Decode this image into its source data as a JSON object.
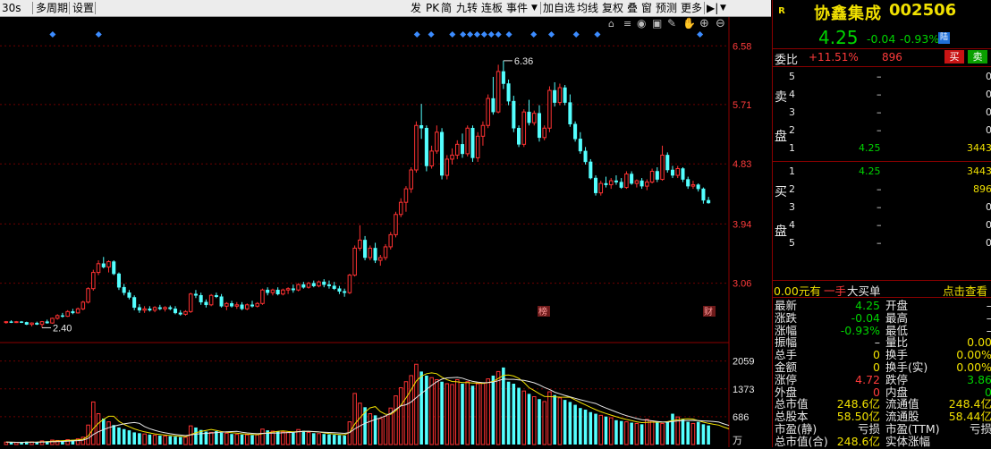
{
  "toolbar": {
    "left_items": [
      "30s",
      "多周期",
      "设置"
    ],
    "right_items": [
      "发",
      "PK",
      "简",
      "九转",
      "连板",
      "事件",
      "加自选",
      "均线",
      "复权",
      "叠",
      "窗",
      "预测",
      "更多"
    ],
    "icons": [
      "dropdown-arrow-icon",
      "home-icon",
      "eye-icon",
      "image-icon",
      "brush-icon",
      "hand-icon",
      "zoom-in-icon",
      "zoom-out-icon",
      "export-icon"
    ]
  },
  "stock": {
    "badge": "R",
    "name": "协鑫集成",
    "code": "002506",
    "price": "4.25",
    "change": "-0.04",
    "change_pct": "-0.93%",
    "tag": "陆"
  },
  "order_book": {
    "weibi_label": "委比",
    "weibi_value": "+11.51%",
    "weibi_diff": "896",
    "buy_btn": "买",
    "sell_btn": "卖",
    "sell_label": "卖盘",
    "buy_label": "买盘",
    "sell": [
      {
        "level": "5",
        "price": "–",
        "vol": "0"
      },
      {
        "level": "4",
        "price": "–",
        "vol": "0"
      },
      {
        "level": "3",
        "price": "–",
        "vol": "0"
      },
      {
        "level": "2",
        "price": "–",
        "vol": "0"
      },
      {
        "level": "1",
        "price": "4.25",
        "vol": "3443"
      }
    ],
    "buy": [
      {
        "level": "1",
        "price": "4.25",
        "vol": "3443"
      },
      {
        "level": "2",
        "price": "–",
        "vol": "896"
      },
      {
        "level": "3",
        "price": "–",
        "vol": "0"
      },
      {
        "level": "4",
        "price": "–",
        "vol": "0"
      },
      {
        "level": "5",
        "price": "–",
        "vol": "0"
      }
    ],
    "big_buy_left": "0.00元有",
    "big_buy_mid": "一手",
    "big_buy_right": "大买单",
    "big_buy_link": "点击查看"
  },
  "stats": [
    {
      "l1": "最新",
      "v1": "4.25",
      "c1": "green",
      "l2": "开盘",
      "v2": "–",
      "c2": "white"
    },
    {
      "l1": "涨跌",
      "v1": "-0.04",
      "c1": "green",
      "l2": "最高",
      "v2": "–",
      "c2": "white"
    },
    {
      "l1": "涨幅",
      "v1": "-0.93%",
      "c1": "green",
      "l2": "最低",
      "v2": "–",
      "c2": "white"
    },
    {
      "l1": "振幅",
      "v1": "–",
      "c1": "white",
      "l2": "量比",
      "v2": "0.00",
      "c2": "yellow"
    },
    {
      "l1": "总手",
      "v1": "0",
      "c1": "yellow",
      "l2": "换手",
      "v2": "0.00%",
      "c2": "yellow"
    },
    {
      "l1": "金额",
      "v1": "0",
      "c1": "yellow",
      "l2": "换手(实)",
      "v2": "0.00%",
      "c2": "yellow"
    },
    {
      "l1": "涨停",
      "v1": "4.72",
      "c1": "red",
      "l2": "跌停",
      "v2": "3.86",
      "c2": "green"
    },
    {
      "l1": "外盘",
      "v1": "0",
      "c1": "red",
      "l2": "内盘",
      "v2": "0",
      "c2": "green"
    },
    {
      "l1": "总市值",
      "v1": "248.6亿",
      "c1": "yellow",
      "l2": "流通值",
      "v2": "248.4亿",
      "c2": "yellow"
    },
    {
      "l1": "总股本",
      "v1": "58.50亿",
      "c1": "yellow",
      "l2": "流通股",
      "v2": "58.44亿",
      "c2": "yellow"
    },
    {
      "l1": "市盈(静)",
      "v1": "亏损",
      "c1": "white",
      "l2": "市盈(TTM)",
      "v2": "亏损",
      "c2": "white"
    },
    {
      "l1": "总市值(合)",
      "v1": "248.6亿",
      "c1": "yellow",
      "l2": "实体涨幅",
      "v2": "",
      "c2": "white"
    }
  ],
  "chart_data": {
    "type": "candlestick",
    "price_axis": {
      "ticks": [
        "6.58",
        "5.71",
        "4.83",
        "3.94",
        "3.06"
      ],
      "range": [
        2.22,
        6.65
      ]
    },
    "volume_axis": {
      "ticks": [
        "2059",
        "1373",
        "686",
        "万"
      ],
      "range": [
        0,
        2250
      ]
    },
    "annotations": {
      "high_label": "6.36",
      "low_label": "2.40",
      "markers": [
        "榜",
        "财"
      ]
    },
    "candles": [
      [
        2.48,
        2.5,
        2.46,
        2.49
      ],
      [
        2.49,
        2.51,
        2.47,
        2.48
      ],
      [
        2.48,
        2.5,
        2.47,
        2.49
      ],
      [
        2.49,
        2.5,
        2.47,
        2.48
      ],
      [
        2.48,
        2.49,
        2.44,
        2.45
      ],
      [
        2.45,
        2.48,
        2.42,
        2.47
      ],
      [
        2.47,
        2.49,
        2.44,
        2.45
      ],
      [
        2.45,
        2.5,
        2.4,
        2.49
      ],
      [
        2.49,
        2.52,
        2.46,
        2.47
      ],
      [
        2.47,
        2.55,
        2.46,
        2.54
      ],
      [
        2.54,
        2.6,
        2.52,
        2.58
      ],
      [
        2.58,
        2.62,
        2.55,
        2.57
      ],
      [
        2.57,
        2.66,
        2.56,
        2.64
      ],
      [
        2.64,
        2.68,
        2.6,
        2.62
      ],
      [
        2.62,
        2.7,
        2.61,
        2.68
      ],
      [
        2.68,
        2.8,
        2.66,
        2.78
      ],
      [
        2.78,
        3.0,
        2.76,
        2.98
      ],
      [
        2.98,
        3.26,
        2.95,
        3.22
      ],
      [
        3.22,
        3.4,
        3.18,
        3.35
      ],
      [
        3.35,
        3.45,
        3.28,
        3.3
      ],
      [
        3.3,
        3.4,
        3.22,
        3.38
      ],
      [
        3.38,
        3.4,
        3.18,
        3.2
      ],
      [
        3.2,
        3.22,
        2.96,
        3.0
      ],
      [
        3.0,
        3.05,
        2.88,
        2.92
      ],
      [
        2.92,
        2.96,
        2.82,
        2.85
      ],
      [
        2.85,
        2.88,
        2.66,
        2.7
      ],
      [
        2.7,
        2.75,
        2.62,
        2.66
      ],
      [
        2.66,
        2.72,
        2.62,
        2.68
      ],
      [
        2.68,
        2.72,
        2.64,
        2.66
      ],
      [
        2.66,
        2.72,
        2.63,
        2.7
      ],
      [
        2.7,
        2.74,
        2.66,
        2.68
      ],
      [
        2.68,
        2.72,
        2.64,
        2.7
      ],
      [
        2.7,
        2.73,
        2.66,
        2.68
      ],
      [
        2.68,
        2.72,
        2.6,
        2.62
      ],
      [
        2.62,
        2.66,
        2.58,
        2.6
      ],
      [
        2.6,
        2.66,
        2.58,
        2.64
      ],
      [
        2.64,
        2.92,
        2.62,
        2.9
      ],
      [
        2.9,
        2.96,
        2.84,
        2.88
      ],
      [
        2.88,
        2.92,
        2.74,
        2.78
      ],
      [
        2.78,
        2.82,
        2.7,
        2.74
      ],
      [
        2.74,
        2.9,
        2.72,
        2.88
      ],
      [
        2.88,
        2.92,
        2.84,
        2.86
      ],
      [
        2.86,
        2.9,
        2.7,
        2.72
      ],
      [
        2.72,
        2.78,
        2.66,
        2.76
      ],
      [
        2.76,
        2.8,
        2.7,
        2.72
      ],
      [
        2.72,
        2.78,
        2.68,
        2.74
      ],
      [
        2.74,
        2.78,
        2.66,
        2.68
      ],
      [
        2.68,
        2.76,
        2.66,
        2.74
      ],
      [
        2.74,
        2.8,
        2.7,
        2.72
      ],
      [
        2.72,
        2.78,
        2.7,
        2.76
      ],
      [
        2.76,
        2.98,
        2.74,
        2.96
      ],
      [
        2.96,
        3.0,
        2.88,
        2.92
      ],
      [
        2.92,
        2.98,
        2.88,
        2.96
      ],
      [
        2.96,
        3.0,
        2.88,
        2.9
      ],
      [
        2.9,
        2.98,
        2.88,
        2.96
      ],
      [
        2.96,
        3.0,
        2.9,
        2.98
      ],
      [
        2.98,
        3.04,
        2.92,
        2.96
      ],
      [
        2.96,
        3.06,
        2.94,
        3.04
      ],
      [
        3.04,
        3.08,
        2.98,
        3.0
      ],
      [
        3.0,
        3.08,
        2.98,
        3.06
      ],
      [
        3.06,
        3.1,
        3.0,
        3.02
      ],
      [
        3.02,
        3.1,
        3.0,
        3.08
      ],
      [
        3.08,
        3.12,
        3.0,
        3.04
      ],
      [
        3.04,
        3.1,
        2.98,
        3.02
      ],
      [
        3.02,
        3.08,
        2.96,
        2.98
      ],
      [
        2.98,
        3.02,
        2.9,
        2.94
      ],
      [
        2.94,
        2.98,
        2.86,
        2.92
      ],
      [
        2.92,
        3.2,
        2.9,
        3.18
      ],
      [
        3.18,
        3.62,
        3.16,
        3.58
      ],
      [
        3.58,
        3.92,
        3.54,
        3.7
      ],
      [
        3.7,
        3.76,
        3.4,
        3.44
      ],
      [
        3.44,
        3.62,
        3.4,
        3.58
      ],
      [
        3.58,
        3.66,
        3.36,
        3.4
      ],
      [
        3.4,
        3.48,
        3.32,
        3.44
      ],
      [
        3.44,
        3.64,
        3.4,
        3.6
      ],
      [
        3.6,
        3.82,
        3.56,
        3.78
      ],
      [
        3.78,
        4.12,
        3.74,
        4.08
      ],
      [
        4.08,
        4.32,
        4.04,
        4.26
      ],
      [
        4.26,
        4.5,
        4.12,
        4.46
      ],
      [
        4.46,
        4.78,
        4.4,
        4.74
      ],
      [
        4.74,
        5.46,
        4.7,
        5.4
      ],
      [
        5.4,
        5.72,
        5.2,
        5.36
      ],
      [
        5.36,
        5.4,
        4.72,
        4.8
      ],
      [
        4.8,
        5.1,
        4.76,
        5.02
      ],
      [
        5.02,
        5.4,
        4.98,
        5.3
      ],
      [
        5.3,
        5.36,
        4.6,
        4.66
      ],
      [
        4.66,
        4.96,
        4.6,
        4.9
      ],
      [
        4.9,
        5.06,
        4.82,
        4.96
      ],
      [
        4.96,
        5.18,
        4.9,
        5.12
      ],
      [
        5.12,
        5.28,
        4.92,
        4.98
      ],
      [
        4.98,
        5.4,
        4.94,
        5.36
      ],
      [
        5.36,
        5.4,
        4.86,
        4.92
      ],
      [
        4.92,
        5.3,
        4.86,
        5.24
      ],
      [
        5.24,
        5.46,
        5.1,
        5.4
      ],
      [
        5.4,
        5.86,
        5.36,
        5.8
      ],
      [
        5.8,
        6.12,
        5.56,
        5.6
      ],
      [
        5.6,
        6.3,
        5.58,
        6.2
      ],
      [
        6.2,
        6.36,
        5.94,
        6.02
      ],
      [
        6.02,
        6.08,
        5.7,
        5.76
      ],
      [
        5.76,
        5.84,
        5.3,
        5.36
      ],
      [
        5.36,
        5.4,
        5.08,
        5.12
      ],
      [
        5.12,
        5.64,
        5.08,
        5.6
      ],
      [
        5.6,
        5.78,
        5.4,
        5.44
      ],
      [
        5.44,
        5.62,
        5.4,
        5.58
      ],
      [
        5.58,
        5.7,
        5.16,
        5.22
      ],
      [
        5.22,
        5.4,
        5.18,
        5.36
      ],
      [
        5.36,
        5.98,
        5.3,
        5.92
      ],
      [
        5.92,
        6.04,
        5.68,
        5.74
      ],
      [
        5.74,
        6.02,
        5.7,
        5.96
      ],
      [
        5.96,
        6.0,
        5.7,
        5.74
      ],
      [
        5.74,
        5.86,
        5.38,
        5.42
      ],
      [
        5.42,
        5.46,
        5.16,
        5.2
      ],
      [
        5.2,
        5.3,
        4.98,
        5.02
      ],
      [
        5.02,
        5.08,
        4.82,
        4.86
      ],
      [
        4.86,
        4.9,
        4.6,
        4.62
      ],
      [
        4.62,
        4.66,
        4.36,
        4.4
      ],
      [
        4.4,
        4.58,
        4.36,
        4.54
      ],
      [
        4.54,
        4.64,
        4.48,
        4.52
      ],
      [
        4.52,
        4.62,
        4.46,
        4.58
      ],
      [
        4.58,
        4.66,
        4.52,
        4.56
      ],
      [
        4.56,
        4.62,
        4.46,
        4.48
      ],
      [
        4.48,
        4.72,
        4.46,
        4.68
      ],
      [
        4.68,
        4.72,
        4.52,
        4.54
      ],
      [
        4.54,
        4.6,
        4.48,
        4.58
      ],
      [
        4.58,
        4.62,
        4.46,
        4.5
      ],
      [
        4.5,
        4.6,
        4.44,
        4.56
      ],
      [
        4.56,
        4.76,
        4.54,
        4.72
      ],
      [
        4.72,
        4.78,
        4.56,
        4.6
      ],
      [
        4.6,
        5.1,
        4.58,
        4.96
      ],
      [
        4.96,
        5.0,
        4.7,
        4.74
      ],
      [
        4.74,
        4.8,
        4.62,
        4.66
      ],
      [
        4.66,
        4.8,
        4.62,
        4.76
      ],
      [
        4.76,
        4.78,
        4.56,
        4.6
      ],
      [
        4.6,
        4.64,
        4.46,
        4.5
      ],
      [
        4.5,
        4.58,
        4.46,
        4.52
      ],
      [
        4.52,
        4.54,
        4.42,
        4.46
      ],
      [
        4.46,
        4.48,
        4.24,
        4.29
      ],
      [
        4.29,
        4.34,
        4.24,
        4.25
      ]
    ],
    "volumes": [
      60,
      55,
      50,
      48,
      72,
      65,
      58,
      90,
      82,
      110,
      100,
      95,
      120,
      115,
      140,
      180,
      480,
      1050,
      760,
      640,
      560,
      480,
      420,
      380,
      350,
      300,
      280,
      260,
      245,
      230,
      220,
      210,
      205,
      195,
      185,
      180,
      460,
      420,
      360,
      320,
      300,
      330,
      290,
      280,
      260,
      250,
      245,
      240,
      235,
      240,
      380,
      350,
      330,
      320,
      310,
      300,
      295,
      370,
      340,
      300,
      280,
      270,
      260,
      250,
      240,
      230,
      220,
      560,
      1260,
      1020,
      920,
      760,
      720,
      640,
      700,
      900,
      1200,
      1400,
      1550,
      1700,
      1980,
      1800,
      1700,
      1650,
      1600,
      1550,
      1500,
      1480,
      1600,
      1500,
      1550,
      1450,
      1500,
      1520,
      1620,
      1700,
      1800,
      1900,
      1550,
      1500,
      1400,
      1320,
      1250,
      1180,
      1120,
      1060,
      1300,
      1220,
      1150,
      1100,
      1050,
      980,
      900,
      860,
      800,
      760,
      720,
      690,
      660,
      600,
      580,
      560,
      540,
      520,
      500,
      620,
      580,
      540,
      520,
      560,
      760,
      680,
      620,
      560,
      520,
      560,
      500,
      470,
      440,
      420,
      320,
      280
    ]
  }
}
